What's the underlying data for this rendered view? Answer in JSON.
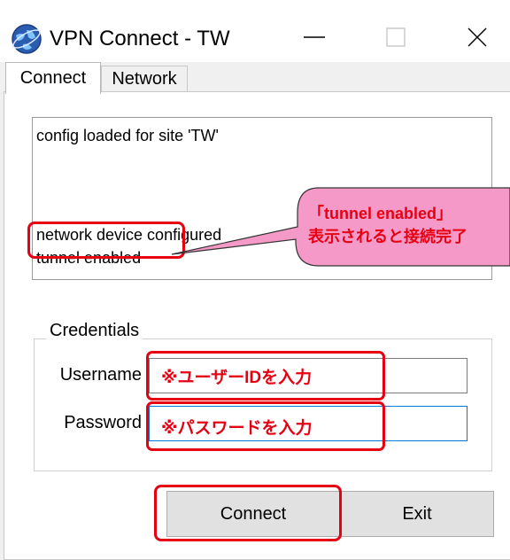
{
  "window": {
    "title": "VPN Connect - TW",
    "app_icon": "globe-icon",
    "controls": {
      "minimize": "minimize-icon",
      "maximize": "maximize-icon",
      "close": "close-icon"
    }
  },
  "tabs": [
    {
      "label": "Connect",
      "active": true
    },
    {
      "label": "Network",
      "active": false
    }
  ],
  "log": {
    "lines": [
      "config loaded for site 'TW'",
      "network device configured",
      "tunnel enabled"
    ]
  },
  "credentials": {
    "legend": "Credentials",
    "username_label": "Username",
    "username_value": "",
    "password_label": "Password",
    "password_value": ""
  },
  "annotations": {
    "username_hint": "※ユーザーIDを入力",
    "password_hint": "※パスワードを入力",
    "callout_line1": "「tunnel enabled」",
    "callout_line2": "表示されると接続完了",
    "accent_color": "#e60012",
    "callout_bg": "#f59ac8"
  },
  "buttons": {
    "connect": "Connect",
    "exit": "Exit"
  }
}
